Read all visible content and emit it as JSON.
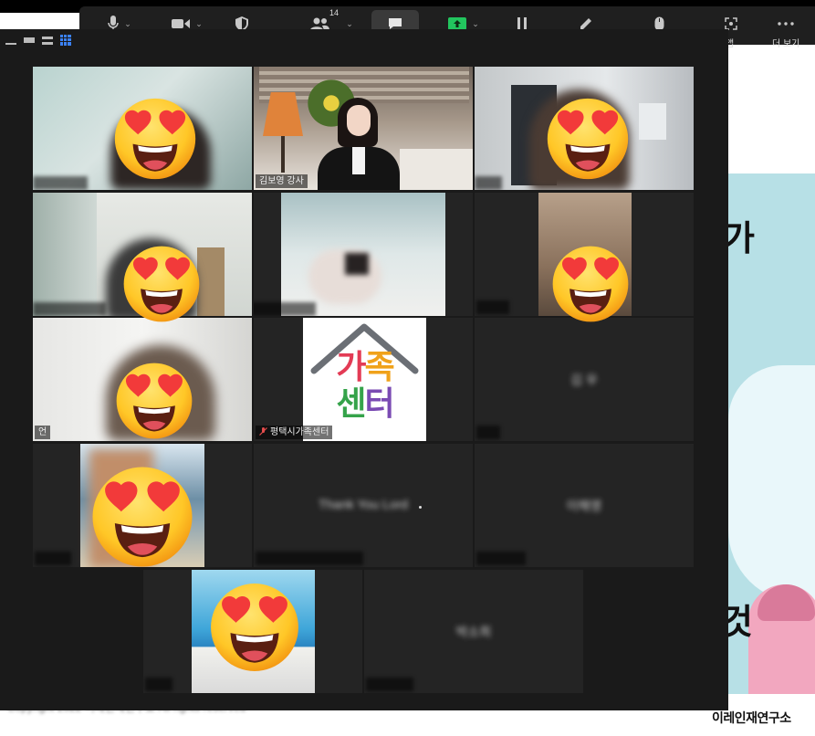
{
  "toolbar": {
    "participants_count": "14",
    "apps_label": "앱",
    "more_label": "더 보기"
  },
  "participants": [
    {
      "id": "p1",
      "label": ""
    },
    {
      "id": "p2",
      "label": "김보영 강사"
    },
    {
      "id": "p3",
      "label": ""
    },
    {
      "id": "p4",
      "label": ""
    },
    {
      "id": "p5",
      "label": ""
    },
    {
      "id": "p6",
      "label": ""
    },
    {
      "id": "p7",
      "label": "",
      "label_tail": "언"
    },
    {
      "id": "p8",
      "label": "평택시가족센터"
    },
    {
      "id": "p9",
      "label": ""
    },
    {
      "id": "p10",
      "label": ""
    },
    {
      "id": "p11",
      "label": ""
    },
    {
      "id": "p12",
      "label": ""
    },
    {
      "id": "p13",
      "label": ""
    },
    {
      "id": "p14",
      "label": ""
    }
  ],
  "family_center_logo": {
    "line1": "가족",
    "line2": "센터"
  },
  "slide": {
    "char_top": "가",
    "char_bottom": "것",
    "brand": "이레인재연구소",
    "copyright": "Copyright 2022 이레인재연구소 All rights reserved"
  },
  "colors": {
    "toolbar_bg": "#1f1f1f",
    "window_bg": "#1a1a1a",
    "tile_bg": "#242424",
    "active_speaker": "#d6df59",
    "share_green": "#22c55e",
    "grid_blue": "#3b82f6"
  }
}
